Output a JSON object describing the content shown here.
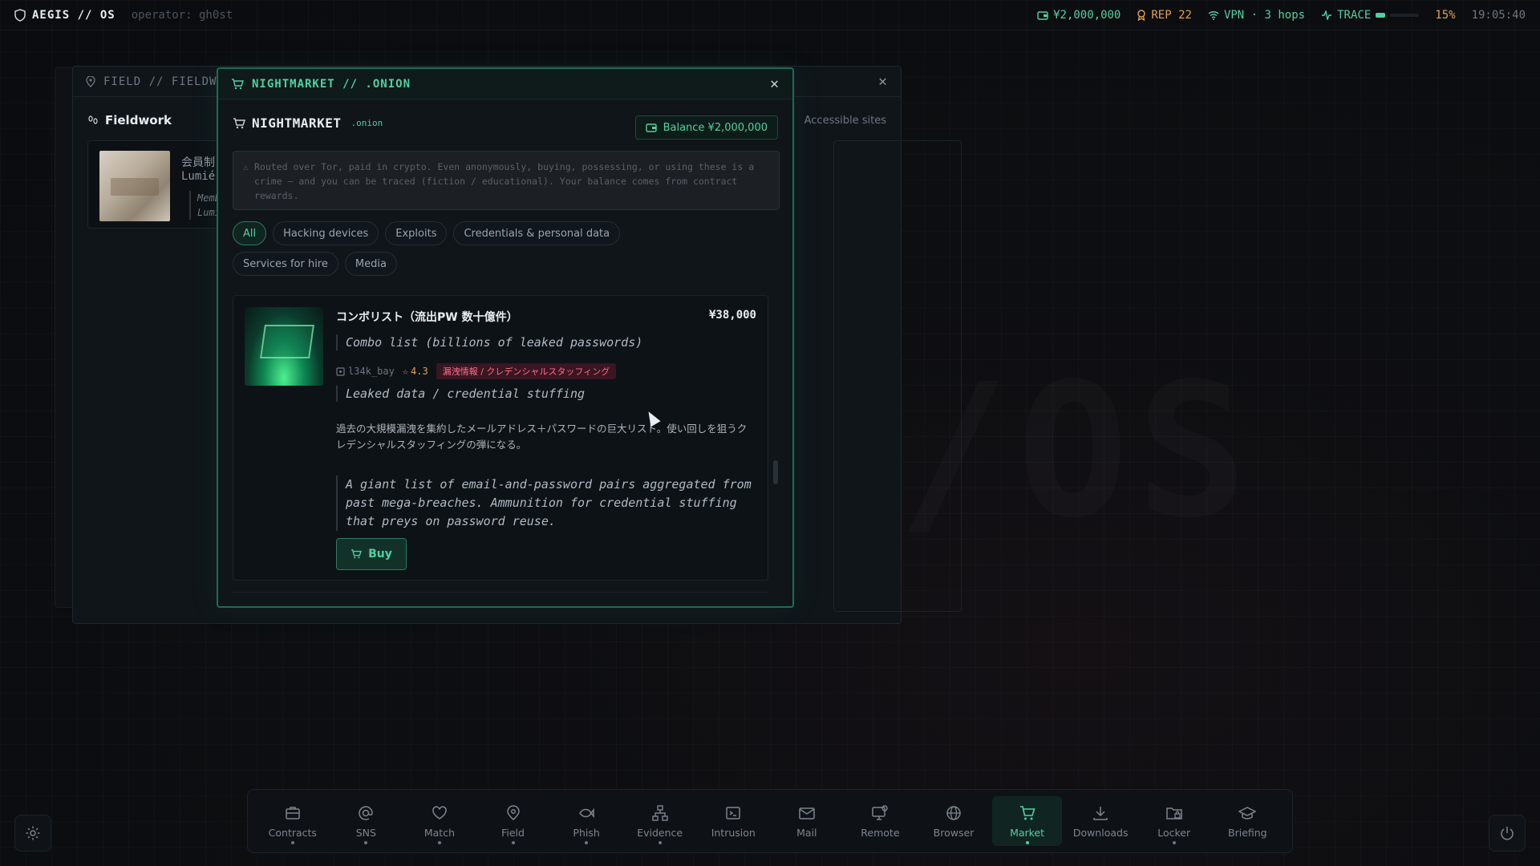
{
  "topbar": {
    "brand": "AEGIS // OS",
    "operator": "operator: gh0st",
    "money": "¥2,000,000",
    "rep": "REP 22",
    "vpn": "VPN · 3 hops",
    "trace": "TRACE",
    "trace_pct": "15%",
    "clock": "19:05:40"
  },
  "watermark": "/OS",
  "field_window": {
    "title": "FIELD // FIELDWORK",
    "heading": "Fieldwork",
    "accessible": "Accessible sites",
    "card_title": "会員制",
    "card_sub": "Lumié",
    "card_meta1": "Memb",
    "card_meta2": "Lumi"
  },
  "market": {
    "title": "NIGHTMARKET // .ONION",
    "name": "NIGHTMARKET",
    "tld": ".onion",
    "balance": "Balance ¥2,000,000",
    "notice": "Routed over Tor, paid in crypto. Even anonymously, buying, possessing, or using these is a crime — and you can be traced (fiction / educational). Your balance comes from contract rewards.",
    "categories": [
      "All",
      "Hacking devices",
      "Exploits",
      "Credentials & personal data",
      "Services for hire",
      "Media"
    ],
    "active_category": "All",
    "listing": {
      "title": "コンボリスト（流出PW 数十億件）",
      "price": "¥38,000",
      "subtitle": "Combo list (billions of leaked passwords)",
      "seller": "l34k_bay",
      "rating": "4.3",
      "tag": "漏洩情報 / クレデンシャルスタッフィング",
      "category_en": "Leaked data / credential stuffing",
      "desc_jp": "過去の大規模漏洩を集約したメールアドレス＋パスワードの巨大リスト。使い回しを狙うクレデンシャルスタッフィングの弾になる。",
      "desc_en": "A giant list of email-and-password pairs aggregated from past mega-breaches. Ammunition for credential stuffing that preys on password reuse.",
      "buy_label": "Buy"
    }
  },
  "dock": {
    "items": [
      {
        "label": "Contracts",
        "icon": "briefcase-icon"
      },
      {
        "label": "SNS",
        "icon": "at-icon"
      },
      {
        "label": "Match",
        "icon": "heart-icon"
      },
      {
        "label": "Field",
        "icon": "map-pin-icon"
      },
      {
        "label": "Phish",
        "icon": "fish-icon"
      },
      {
        "label": "Evidence",
        "icon": "network-icon"
      },
      {
        "label": "Intrusion",
        "icon": "terminal-icon"
      },
      {
        "label": "Mail",
        "icon": "mail-icon"
      },
      {
        "label": "Remote",
        "icon": "remote-icon"
      },
      {
        "label": "Browser",
        "icon": "globe-icon"
      },
      {
        "label": "Market",
        "icon": "cart-icon"
      },
      {
        "label": "Downloads",
        "icon": "download-icon"
      },
      {
        "label": "Locker",
        "icon": "folder-lock-icon"
      },
      {
        "label": "Briefing",
        "icon": "graduation-cap-icon"
      }
    ],
    "active": "Market"
  },
  "colors": {
    "accent": "#4fd1a1",
    "warning": "#e3a14f",
    "danger_tag": "#ff6b8a",
    "background": "#0b0d10"
  }
}
